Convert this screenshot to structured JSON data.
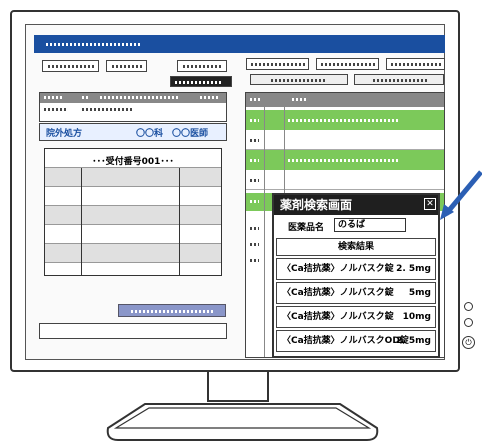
{
  "left_panel": {
    "rx_label": "院外処方",
    "department": "〇〇科　〇〇医師",
    "receipt_number": "･･･受付番号001･･･"
  },
  "popup": {
    "title": "薬剤検索画面",
    "field_label": "医薬品名",
    "field_value": "のるば",
    "results_header": "検索結果",
    "results": [
      {
        "name": "〈Ca拮抗薬〉ノルバスク錠",
        "strength": "2. 5mg"
      },
      {
        "name": "〈Ca拮抗薬〉ノルバスク錠",
        "strength": "5mg"
      },
      {
        "name": "〈Ca拮抗薬〉ノルバスク錠",
        "strength": "10mg"
      },
      {
        "name": "〈Ca拮抗薬〉ノルバスクOD錠",
        "strength": "2. 5mg"
      }
    ]
  },
  "colors": {
    "title_bar": "#1a4fa0",
    "highlight_row": "#7cc95a",
    "popup_header": "#1f1f1f"
  },
  "icons": [
    "power-icon",
    "close-icon",
    "pointer-arrow-icon"
  ]
}
